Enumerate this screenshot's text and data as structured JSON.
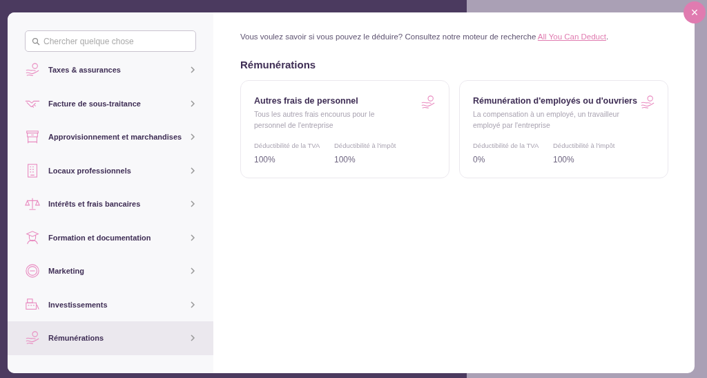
{
  "sidebar": {
    "search": {
      "placeholder": "Chercher quelque chose"
    },
    "items": [
      {
        "label": "Taxes & assurances",
        "selected": false
      },
      {
        "label": "Facture de sous-traitance",
        "selected": false
      },
      {
        "label": "Approvisionnement et marchandises",
        "selected": false
      },
      {
        "label": "Locaux professionnels",
        "selected": false
      },
      {
        "label": "Intérêts et frais bancaires",
        "selected": false
      },
      {
        "label": "Formation et documentation",
        "selected": false
      },
      {
        "label": "Marketing",
        "selected": false
      },
      {
        "label": "Investissements",
        "selected": false
      },
      {
        "label": "Rémunérations",
        "selected": true
      }
    ]
  },
  "intro": {
    "text": "Vous voulez savoir si vous pouvez le déduire? Consultez notre moteur de recherche ",
    "link": "All You Can Deduct",
    "end": "."
  },
  "section_title": "Rémunérations",
  "cards": [
    {
      "title": "Autres frais de personnel",
      "description": "Tous les autres frais encourus pour le personnel de l'entreprise",
      "stats": [
        {
          "label": "Déductibilité de la TVA",
          "value": "100%"
        },
        {
          "label": "Déductibilité à l'impôt",
          "value": "100%"
        }
      ]
    },
    {
      "title": "Rémunération d'employés ou d'ouvriers",
      "description": "La compensation à un employé, un travailleur employé par l'entreprise",
      "stats": [
        {
          "label": "Déductibilité de la TVA",
          "value": "0%"
        },
        {
          "label": "Déductibilité à l'impôt",
          "value": "100%"
        }
      ]
    }
  ],
  "close": "×"
}
